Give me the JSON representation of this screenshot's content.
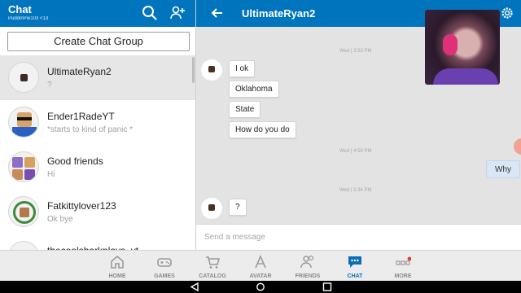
{
  "left_header": {
    "title": "Chat",
    "subtitle": "PuddinPie103 <13"
  },
  "create_group_label": "Create Chat Group",
  "conversations": [
    {
      "name": "UltimateRyan2",
      "preview": "?"
    },
    {
      "name": "Ender1RadeYT",
      "preview": "*starts to kind of panic *"
    },
    {
      "name": "Good friends",
      "preview": "Hi"
    },
    {
      "name": "Fatkittylover123",
      "preview": "Ok bye"
    },
    {
      "name": "thecoolsharkplays_yt",
      "preview": ""
    }
  ],
  "chat": {
    "title": "UltimateRyan2",
    "timestamps": [
      "Wed | 3:53 PM",
      "Wed | 4:59 PM",
      "Wed | 5:34 PM"
    ],
    "messages_in": [
      "I ok",
      "Oklahoma",
      "State",
      "How do you do",
      "?"
    ],
    "messages_out": [
      "Why"
    ],
    "input_placeholder": "Send a message"
  },
  "nav": [
    {
      "label": "HOME",
      "icon": "home-icon"
    },
    {
      "label": "GAMES",
      "icon": "gamepad-icon"
    },
    {
      "label": "CATALOG",
      "icon": "cart-icon"
    },
    {
      "label": "AVATAR",
      "icon": "avatar-icon"
    },
    {
      "label": "FRIENDS",
      "icon": "friends-icon"
    },
    {
      "label": "CHAT",
      "icon": "chat-icon"
    },
    {
      "label": "MORE",
      "icon": "more-icon"
    }
  ],
  "colors": {
    "header": "#0074bd",
    "active_nav": "#0a6fb8",
    "notification": "#e43b2f"
  }
}
